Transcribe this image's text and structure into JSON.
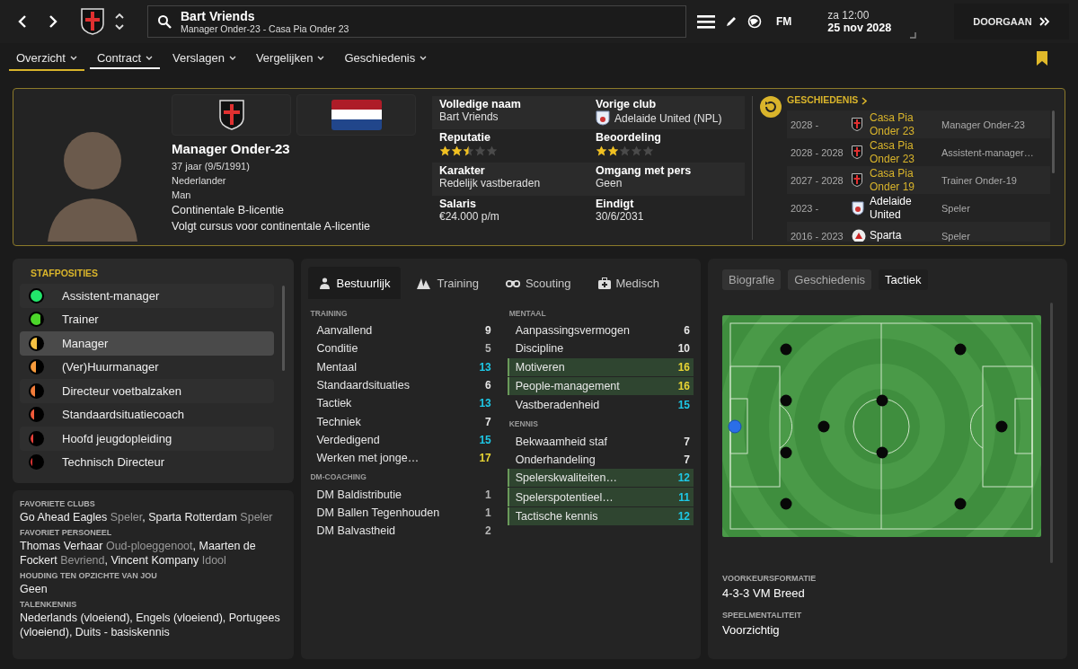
{
  "topbar": {
    "title": "Bart Vriends",
    "subtitle": "Manager Onder-23 - Casa Pia Onder 23",
    "fm_label": "FM",
    "day": "za 12:00",
    "date": "25 nov 2028",
    "continue_button": "DOORGAAN"
  },
  "nav_tabs": [
    {
      "label": "Overzicht",
      "selected": true,
      "hovered": false
    },
    {
      "label": "Contract",
      "selected": false,
      "hovered": true
    },
    {
      "label": "Verslagen",
      "selected": false,
      "hovered": false
    },
    {
      "label": "Vergelijken",
      "selected": false,
      "hovered": false
    },
    {
      "label": "Geschiedenis",
      "selected": false,
      "hovered": false
    }
  ],
  "profile": {
    "role": "Manager Onder-23",
    "age": "37 jaar (9/5/1991)",
    "nationality": "Nederlander",
    "gender": "Man",
    "licence": "Continentale B-licentie",
    "course": "Volgt cursus voor continentale A-licentie"
  },
  "details": [
    {
      "label": "Volledige naam",
      "kind": "text",
      "value": "Bart Vriends"
    },
    {
      "label": "Vorige club",
      "kind": "club",
      "value": "Adelaide United (NPL)"
    },
    {
      "label": "Reputatie",
      "kind": "stars",
      "stars": 2.5
    },
    {
      "label": "Beoordeling",
      "kind": "stars",
      "stars": 2
    },
    {
      "label": "Karakter",
      "kind": "text",
      "value": "Redelijk vastberaden"
    },
    {
      "label": "Omgang met pers",
      "kind": "text",
      "value": "Geen"
    },
    {
      "label": "Salaris",
      "kind": "text",
      "value": "€24.000 p/m"
    },
    {
      "label": "Eindigt",
      "kind": "text",
      "value": "30/6/2031"
    }
  ],
  "history": {
    "title": "GESCHIEDENIS",
    "rows": [
      {
        "years": "2028 -",
        "club": "Casa Pia Onder 23",
        "role": "Manager Onder-23",
        "own_club": true,
        "kind": "cross"
      },
      {
        "years": "2028 - 2028",
        "club": "Casa Pia Onder 23",
        "role": "Assistent-manager…",
        "own_club": true,
        "kind": "cross"
      },
      {
        "years": "2027 - 2028",
        "club": "Casa Pia Onder 19",
        "role": "Trainer Onder-19",
        "own_club": true,
        "kind": "cross"
      },
      {
        "years": "2023 -",
        "club": "Adelaide United",
        "role": "Speler",
        "own_club": false,
        "kind": "shield"
      },
      {
        "years": "2016 - 2023",
        "club": "Sparta",
        "role": "Speler",
        "own_club": false,
        "kind": "round"
      }
    ]
  },
  "staff_positions": {
    "title": "STAFPOSITIES",
    "items": [
      {
        "label": "Assistent-manager",
        "level": 1,
        "color": "#22e66b",
        "selected": false
      },
      {
        "label": "Trainer",
        "level": 0.85,
        "color": "#4cd62a",
        "selected": false
      },
      {
        "label": "Manager",
        "level": 0.5,
        "color": "#f5c142",
        "selected": true
      },
      {
        "label": "(Ver)Huurmanager",
        "level": 0.45,
        "color": "#f59a3c",
        "selected": false
      },
      {
        "label": "Directeur voetbalzaken",
        "level": 0.4,
        "color": "#f27c3a",
        "selected": false
      },
      {
        "label": "Standaardsituatiecoach",
        "level": 0.3,
        "color": "#ef5a3a",
        "selected": false
      },
      {
        "label": "Hoofd jeugdopleiding",
        "level": 0.25,
        "color": "#e8413a",
        "selected": false
      },
      {
        "label": "Technisch Directeur",
        "level": 0.15,
        "color": "#e03535",
        "selected": false
      }
    ]
  },
  "preferences": [
    {
      "label": "FAVORIETE CLUBS",
      "parts": [
        {
          "name": "Go Ahead Eagles",
          "relation": "Speler",
          "sep": ","
        },
        {
          "name": "Sparta Rotterdam",
          "relation": "Speler"
        }
      ]
    },
    {
      "label": "FAVORIET PERSONEEL",
      "parts": [
        {
          "name": "Thomas Verhaar",
          "relation": "Oud-ploeggenoot",
          "sep": ","
        },
        {
          "name": "Maarten de Fockert",
          "relation": "Bevriend",
          "sep": ","
        },
        {
          "name": "Vincent Kompany",
          "relation": "Idool"
        }
      ]
    },
    {
      "label": "HOUDING TEN OPZICHTE VAN JOU",
      "parts": [
        {
          "name": "Geen"
        }
      ]
    },
    {
      "label": "TALENKENNIS",
      "parts": [
        {
          "name": "Nederlands (vloeiend), Engels (vloeiend), Portugees (vloeiend), Duits - basiskennis"
        }
      ]
    }
  ],
  "attribute_tabs": [
    {
      "label": "Bestuurlijk",
      "selected": true
    },
    {
      "label": "Training",
      "selected": false
    },
    {
      "label": "Scouting",
      "selected": false
    },
    {
      "label": "Medisch",
      "selected": false
    }
  ],
  "attribute_columns": [
    [
      {
        "title": "TRAINING",
        "items": [
          {
            "name": "Aanvallend",
            "value": "9",
            "color": "#e6e6e6",
            "highlighted": false
          },
          {
            "name": "Conditie",
            "value": "5",
            "color": "#b5b5b5",
            "highlighted": false
          },
          {
            "name": "Mentaal",
            "value": "13",
            "color": "#1ec8e6",
            "highlighted": false
          },
          {
            "name": "Standaardsituaties",
            "value": "6",
            "color": "#e6e6e6",
            "highlighted": false
          },
          {
            "name": "Tactiek",
            "value": "13",
            "color": "#1ec8e6",
            "highlighted": false
          },
          {
            "name": "Techniek",
            "value": "7",
            "color": "#e6e6e6",
            "highlighted": false
          },
          {
            "name": "Verdedigend",
            "value": "15",
            "color": "#1ec8e6",
            "highlighted": false
          },
          {
            "name": "Werken met jonge…",
            "value": "17",
            "color": "#e8d534",
            "highlighted": false
          }
        ]
      },
      {
        "title": "DM-COACHING",
        "items": [
          {
            "name": "DM Baldistributie",
            "value": "1",
            "color": "#b5b5b5",
            "highlighted": false
          },
          {
            "name": "DM Ballen Tegenhouden",
            "value": "1",
            "color": "#b5b5b5",
            "highlighted": false
          },
          {
            "name": "DM Balvastheid",
            "value": "2",
            "color": "#b5b5b5",
            "highlighted": false
          }
        ]
      }
    ],
    [
      {
        "title": "MENTAAL",
        "items": [
          {
            "name": "Aanpassingsvermogen",
            "value": "6",
            "color": "#e6e6e6",
            "highlighted": false
          },
          {
            "name": "Discipline",
            "value": "10",
            "color": "#e6e6e6",
            "highlighted": false
          },
          {
            "name": "Motiveren",
            "value": "16",
            "color": "#e8d534",
            "highlighted": true
          },
          {
            "name": "People-management",
            "value": "16",
            "color": "#e8d534",
            "highlighted": true
          },
          {
            "name": "Vastberadenheid",
            "value": "15",
            "color": "#1ec8e6",
            "highlighted": false
          }
        ]
      },
      {
        "title": "KENNIS",
        "items": [
          {
            "name": "Bekwaamheid staf",
            "value": "7",
            "color": "#e6e6e6",
            "highlighted": false
          },
          {
            "name": "Onderhandeling",
            "value": "7",
            "color": "#e6e6e6",
            "highlighted": false
          },
          {
            "name": "Spelerskwaliteiten…",
            "value": "12",
            "color": "#1ec8e6",
            "highlighted": true
          },
          {
            "name": "Spelerspotentieel…",
            "value": "11",
            "color": "#1ec8e6",
            "highlighted": true
          },
          {
            "name": "Tactische kennis",
            "value": "12",
            "color": "#1ec8e6",
            "highlighted": true
          }
        ]
      }
    ]
  ],
  "side_tabs": [
    {
      "label": "Biografie",
      "selected": false
    },
    {
      "label": "Geschiedenis",
      "selected": false
    },
    {
      "label": "Tactiek",
      "selected": true
    }
  ],
  "tactics": [
    {
      "label": "VOORKEURSFORMATIE",
      "value": "4-3-3 VM Breed"
    },
    {
      "label": "SPEELMENTALITEIT",
      "value": "Voorzichtig"
    }
  ]
}
